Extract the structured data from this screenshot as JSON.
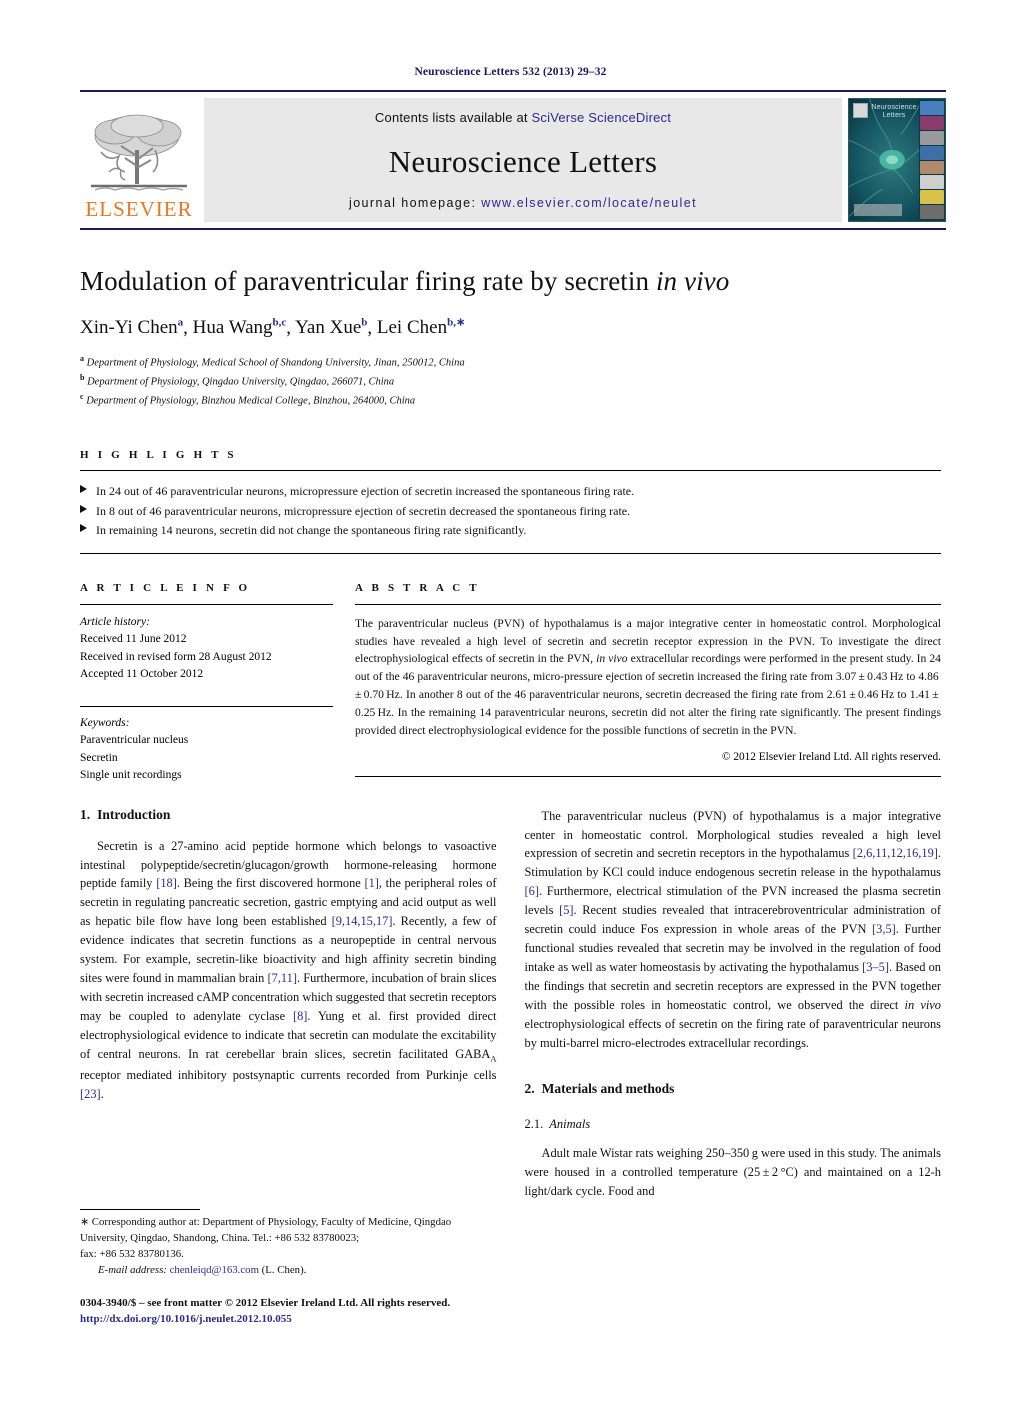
{
  "running_head": "Neuroscience Letters 532 (2013) 29–32",
  "banner": {
    "publisher_name": "ELSEVIER",
    "contents_prefix": "Contents lists available at ",
    "contents_link": "SciVerse ScienceDirect",
    "journal_title": "Neuroscience Letters",
    "homepage_prefix": "journal homepage:",
    "homepage_url": "www.elsevier.com/locate/neulet",
    "cover_title": "Neuroscience Letters",
    "accent_orange": "#E87722",
    "link_blue": "#2b2b8f",
    "rule_navy": "#1a1a5e"
  },
  "article": {
    "title_main": "Modulation of paraventricular firing rate by secretin ",
    "title_italic": "in vivo",
    "authors": [
      {
        "name": "Xin-Yi Chen",
        "sup": "a",
        "sep": ", "
      },
      {
        "name": "Hua Wang",
        "sup": "b,c",
        "sep": ", "
      },
      {
        "name": "Yan Xue",
        "sup": "b",
        "sep": ", "
      },
      {
        "name": "Lei Chen",
        "sup": "b,∗",
        "sep": ""
      }
    ],
    "affiliations": [
      {
        "mark": "a",
        "text": "Department of Physiology, Medical School of Shandong University, Jinan, 250012, China"
      },
      {
        "mark": "b",
        "text": "Department of Physiology, Qingdao University, Qingdao, 266071, China"
      },
      {
        "mark": "c",
        "text": "Department of Physiology, Binzhou Medical College, Binzhou, 264000, China"
      }
    ]
  },
  "highlights": {
    "label": "H I G H L I G H T S",
    "items": [
      "In 24 out of 46 paraventricular neurons, micropressure ejection of secretin increased the spontaneous firing rate.",
      "In 8 out of 46 paraventricular neurons, micropressure ejection of secretin decreased the spontaneous firing rate.",
      "In remaining 14 neurons, secretin did not change the spontaneous firing rate significantly."
    ]
  },
  "article_info": {
    "label": "A R T I C L E    I N F O",
    "history_label": "Article history:",
    "history": [
      "Received 11 June 2012",
      "Received in revised form 28 August 2012",
      "Accepted 11 October 2012"
    ],
    "keywords_label": "Keywords:",
    "keywords": [
      "Paraventricular nucleus",
      "Secretin",
      "Single unit recordings"
    ]
  },
  "abstract": {
    "label": "A B S T R A C T",
    "part1": "The paraventricular nucleus (PVN) of hypothalamus is a major integrative center in homeostatic control. Morphological studies have revealed a high level of secretin and secretin receptor expression in the PVN. To investigate the direct electrophysiological effects of secretin in the PVN, ",
    "italic1": "in vivo",
    "part2": " extracellular recordings were performed in the present study. In 24 out of the 46 paraventricular neurons, micro-pressure ejection of secretin increased the firing rate from 3.07 ± 0.43 Hz to 4.86 ± 0.70 Hz. In another 8 out of the 46 paraventricular neurons, secretin decreased the firing rate from 2.61 ± 0.46 Hz to 1.41 ± 0.25 Hz. In the remaining 14 paraventricular neurons, secretin did not alter the firing rate significantly. The present findings provided direct electrophysiological evidence for the possible functions of secretin in the PVN.",
    "copyright": "© 2012 Elsevier Ireland Ltd. All rights reserved."
  },
  "body": {
    "intro": {
      "number": "1.",
      "heading": "Introduction",
      "p1_a": "Secretin is a 27-amino acid peptide hormone which belongs to vasoactive intestinal polypeptide/secretin/glucagon/growth hormone-releasing hormone peptide family ",
      "r18": "[18]",
      "p1_b": ". Being the first discovered hormone ",
      "r1": "[1]",
      "p1_c": ", the peripheral roles of secretin in regulating pancreatic secretion, gastric emptying and acid output as well as hepatic bile flow have long been established ",
      "r9": "[9,14,15,17]",
      "p1_d": ". Recently, a few of evidence indicates that secretin functions as a neuropeptide in central nervous system. For example, secretin-like bioactivity and high affinity secretin binding sites were found in mammalian brain ",
      "r7": "[7,11]",
      "p1_e": ". Furthermore, incubation of brain slices with secretin increased cAMP concentration which suggested that secretin receptors may be coupled to adenylate cyclase ",
      "r8": "[8]",
      "p1_f": ". Yung et al. first provided direct electrophysiological evidence to indicate that secretin can modulate the excitability of central neurons. In rat cerebellar brain slices, secretin facilitated GABA",
      "sub_a": "A",
      "p1_g": " receptor mediated inhibitory postsynaptic currents recorded from Purkinje cells ",
      "r23": "[23]",
      "p1_h": "."
    },
    "right": {
      "p2_a": "The paraventricular nucleus (PVN) of hypothalamus is a major integrative center in homeostatic control. Morphological studies revealed a high level expression of secretin and secretin receptors in the hypothalamus ",
      "r2": "[2,6,11,12,16,19]",
      "p2_b": ". Stimulation by KCl could induce endogenous secretin release in the hypothalamus ",
      "r6": "[6]",
      "p2_c": ". Furthermore, electrical stimulation of the PVN increased the plasma secretin levels ",
      "r5": "[5]",
      "p2_d": ". Recent studies revealed that intracerebroventricular administration of secretin could induce Fos expression in whole areas of the PVN ",
      "r35": "[3,5]",
      "p2_e": ". Further functional studies revealed that secretin may be involved in the regulation of food intake as well as water homeostasis by activating the hypothalamus ",
      "r345": "[3–5]",
      "p2_f": ". Based on the findings that secretin and secretin receptors are expressed in the PVN together with the possible roles in homeostatic control, we observed the direct ",
      "it_invivo": "in vivo",
      "p2_g": " electrophysiological effects of secretin on the firing rate of paraventricular neurons by multi-barrel micro-electrodes extracellular recordings."
    },
    "methods": {
      "number": "2.",
      "heading": "Materials and methods",
      "sub_number": "2.1.",
      "sub_heading": "Animals",
      "p3": "Adult male Wistar rats weighing 250–350 g were used in this study. The animals were housed in a controlled temperature (25 ± 2 °C) and maintained on a 12-h light/dark cycle. Food and"
    }
  },
  "footnote": {
    "star": "∗",
    "corr_text": " Corresponding author at: Department of Physiology, Faculty of Medicine, Qingdao University, Qingdao, Shandong, China. Tel.: +86 532 83780023;",
    "fax": "fax: +86 532 83780136.",
    "email_label": "E-mail address:",
    "email": "chenleiqd@163.com",
    "email_suffix": " (L. Chen).",
    "issn_line": "0304-3940/$ – see front matter © 2012 Elsevier Ireland Ltd. All rights reserved.",
    "doi": "http://dx.doi.org/10.1016/j.neulet.2012.10.055"
  }
}
